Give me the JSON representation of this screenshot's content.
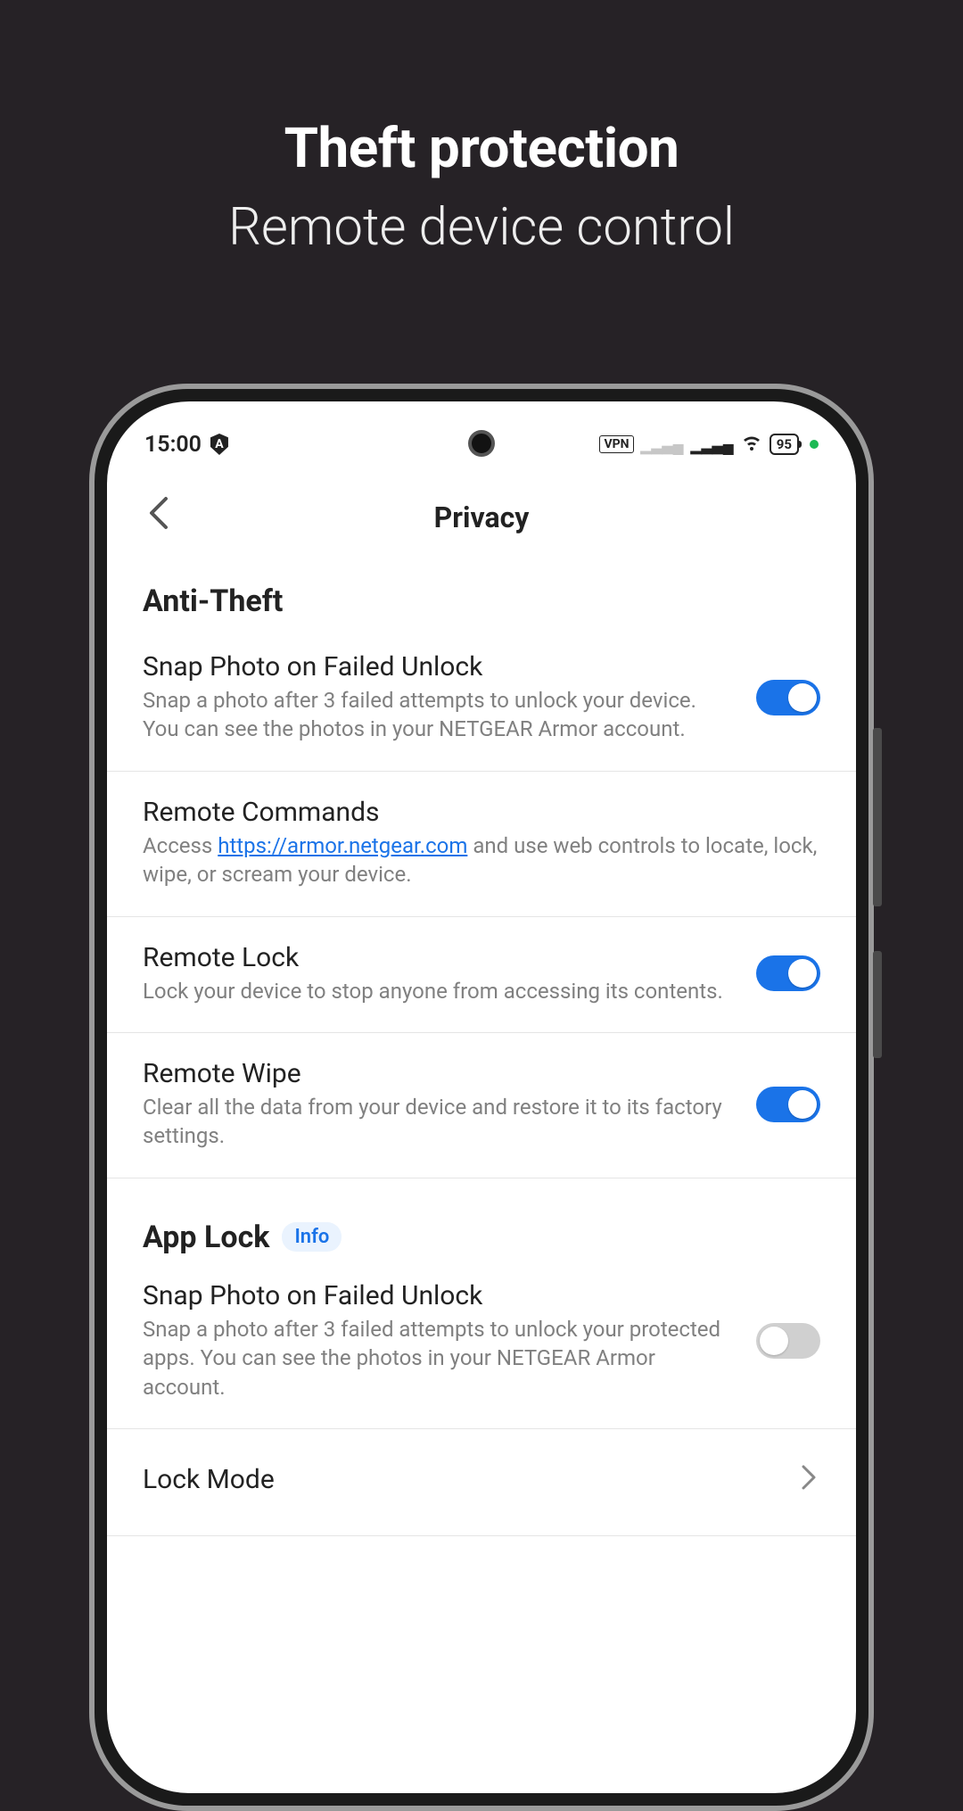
{
  "colors": {
    "accent": "#1a73e8",
    "background": "#262226"
  },
  "promo": {
    "title": "Theft protection",
    "subtitle": "Remote device control"
  },
  "status_bar": {
    "time": "15:00",
    "shield_letter": "A",
    "vpn_label": "VPN",
    "battery_level": "95"
  },
  "header": {
    "title": "Privacy"
  },
  "sections": {
    "anti_theft": {
      "title": "Anti-Theft",
      "items": {
        "snap_photo": {
          "title": "Snap Photo on Failed Unlock",
          "desc": "Snap a photo after 3 failed attempts to unlock your device. You can see the photos in your NETGEAR Armor account.",
          "enabled": true
        },
        "remote_commands": {
          "title": "Remote Commands",
          "desc_pre": "Access ",
          "desc_link": "https://armor.netgear.com",
          "desc_post": " and use web controls to locate, lock, wipe, or scream your device."
        },
        "remote_lock": {
          "title": "Remote Lock",
          "desc": "Lock your device to stop anyone from accessing its contents.",
          "enabled": true
        },
        "remote_wipe": {
          "title": "Remote Wipe",
          "desc": "Clear all the data from your device and restore it to its factory settings.",
          "enabled": true
        }
      }
    },
    "app_lock": {
      "title": "App Lock",
      "badge": "Info",
      "items": {
        "snap_photo": {
          "title": "Snap Photo on Failed Unlock",
          "desc": "Snap a photo after 3 failed attempts to unlock your protected apps. You can see the photos in your NETGEAR Armor account.",
          "enabled": false
        },
        "lock_mode": {
          "title": "Lock Mode"
        }
      }
    }
  }
}
